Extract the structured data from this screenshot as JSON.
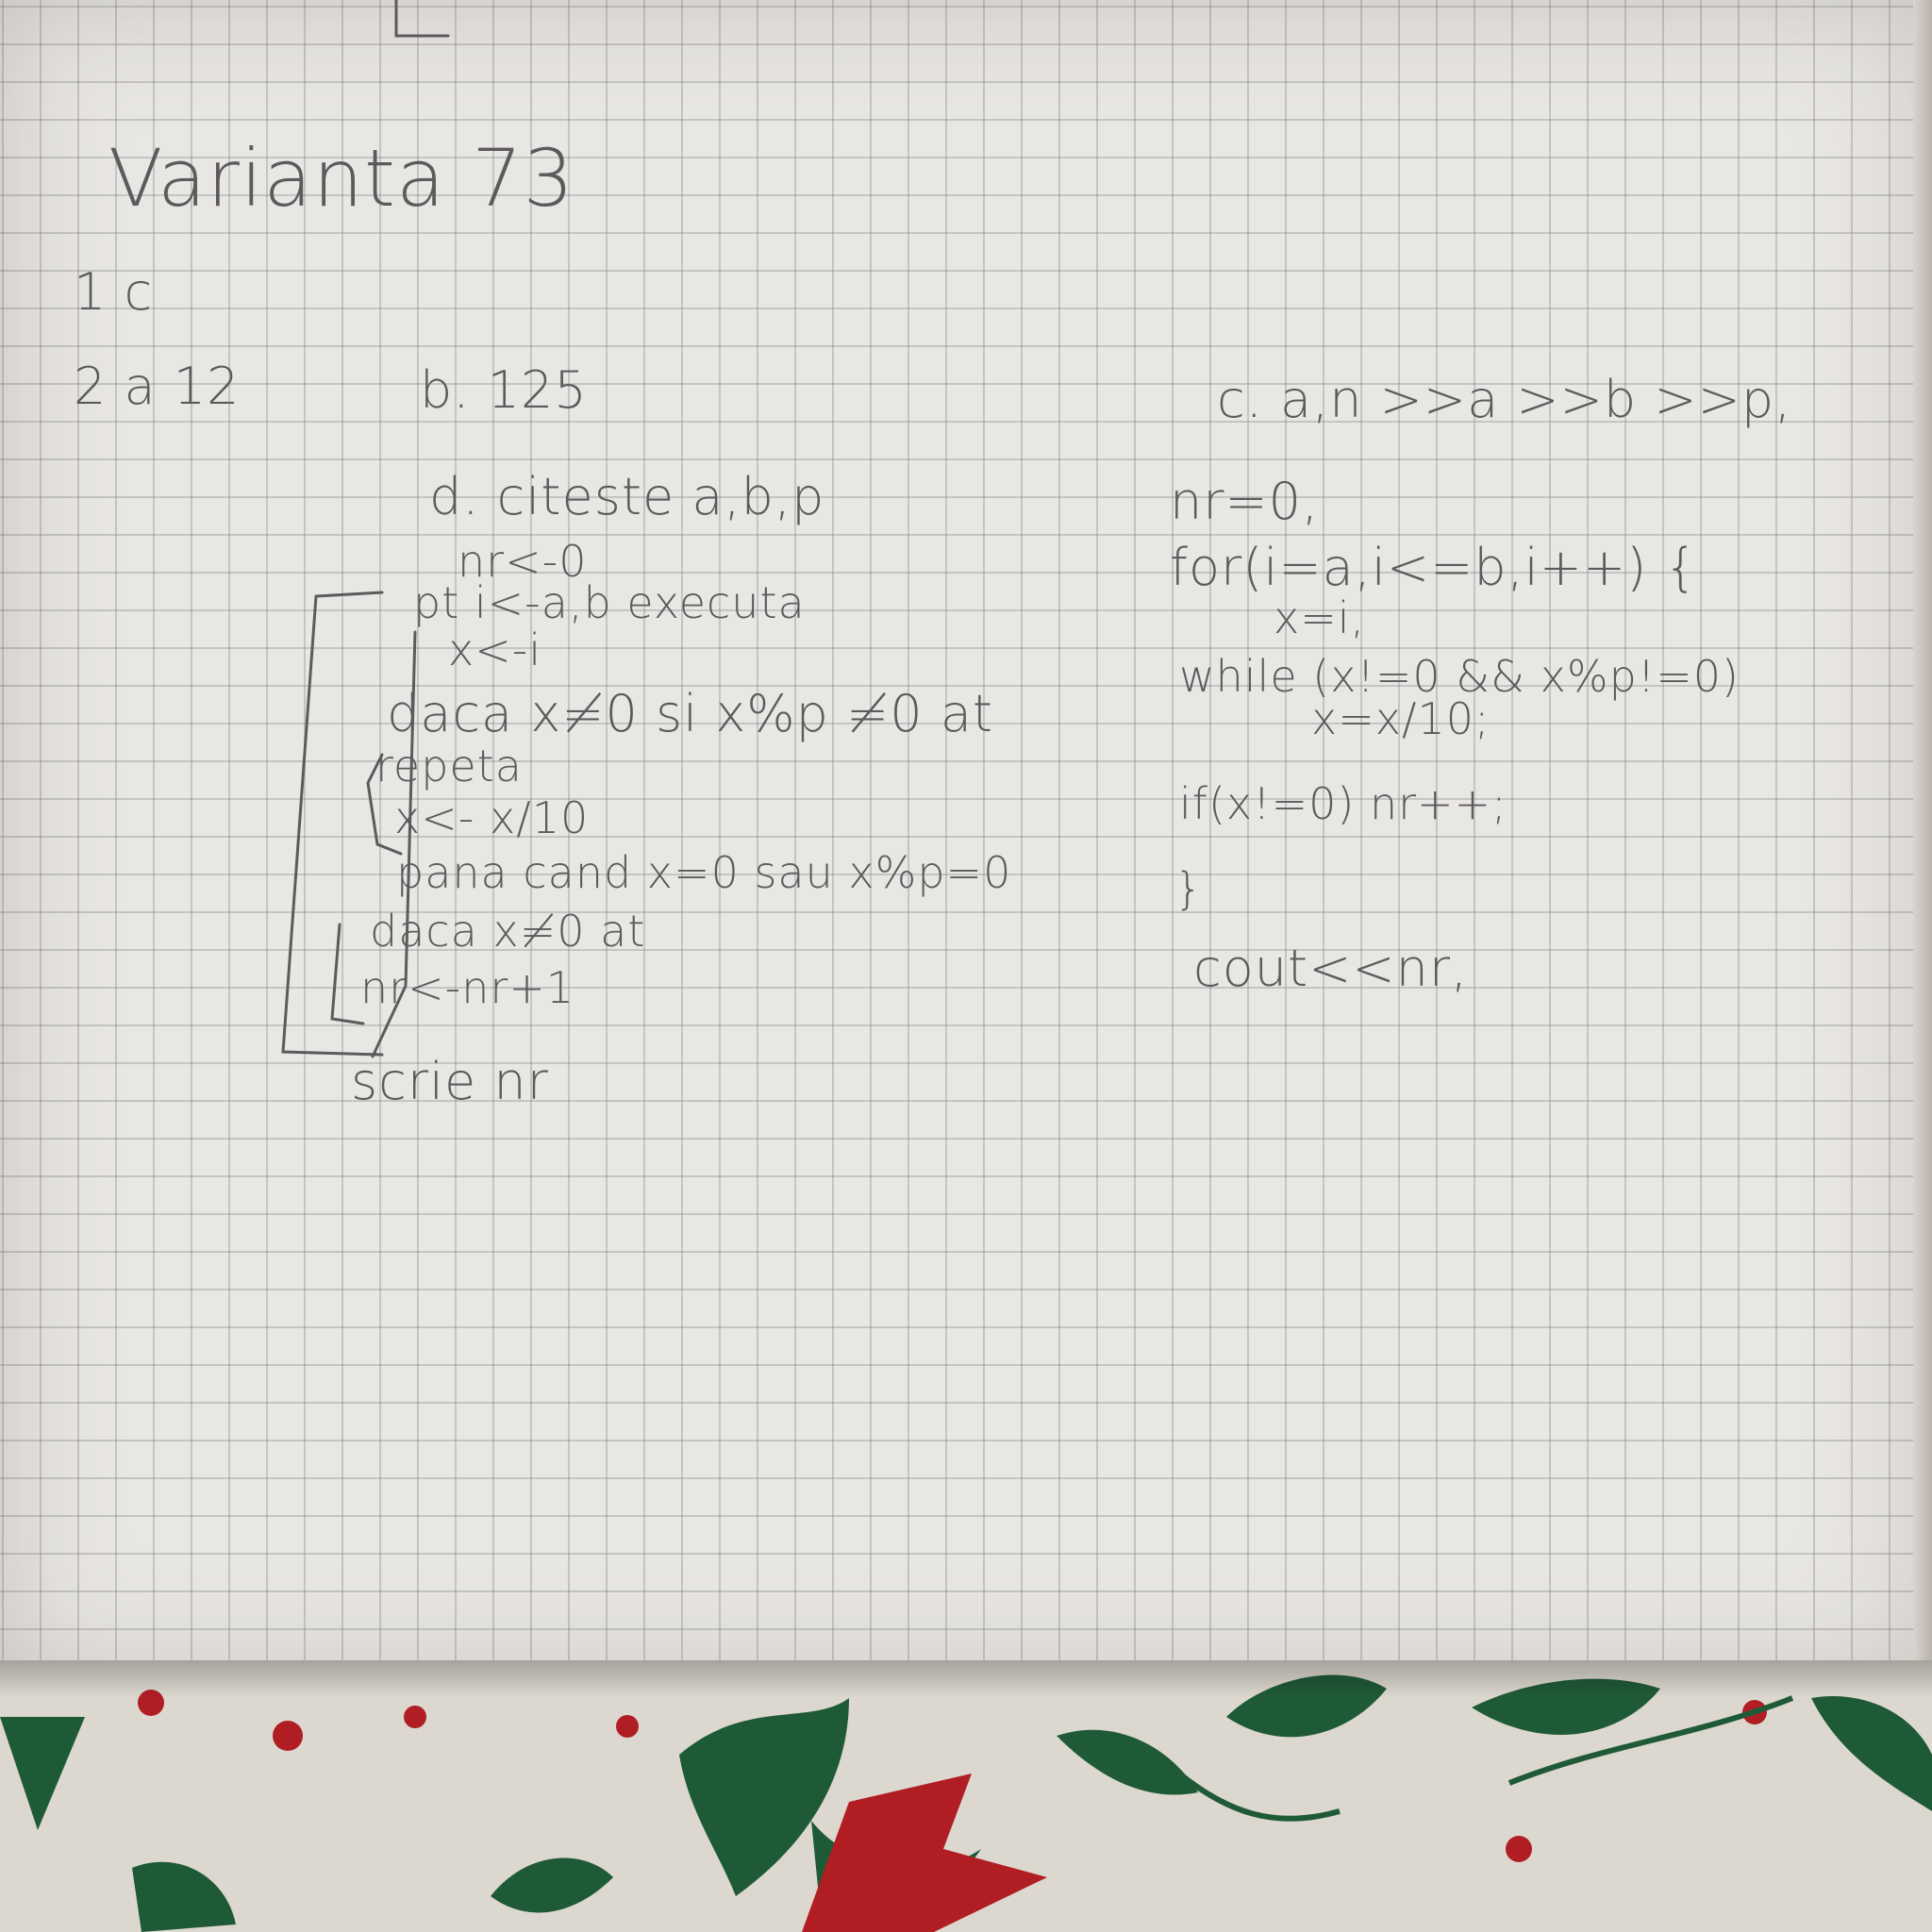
{
  "page": {
    "title": "Varianta 73",
    "answers": {
      "q1": "1 c",
      "q2a": "2 a 12",
      "q2b": "b. 125",
      "q2c_header": "c. a,n >>a >>b >>p,"
    },
    "pseudocode": {
      "header": "d. citeste a,b,p",
      "lines": [
        "nr<-0",
        "pt i<-a,b executa",
        "x<-i",
        "daca x≠0 si x%p ≠0 at",
        "repeta",
        "x<- x/10",
        "pana cand x=0 sau x%p=0",
        "daca x≠0 at",
        "nr<-nr+1",
        "scrie nr"
      ]
    },
    "cpp_code": {
      "lines": [
        "nr=0,",
        "for(i=a,i<=b,i++) {",
        "x=i,",
        "while (x!=0 && x%p!=0)",
        "x=x/10;",
        "if(x!=0) nr++;",
        "}",
        "cout<<nr,"
      ]
    }
  },
  "colors": {
    "ink": "#5c5a5c",
    "paper": "#e9e7e4",
    "grid": "#8a8a90",
    "fabric": "#dcd8cf",
    "holly_green": "#1f5a36",
    "berry_red": "#b01e24"
  },
  "icons": [
    "bracket-line",
    "holly-leaf-icon",
    "berry-icon"
  ]
}
